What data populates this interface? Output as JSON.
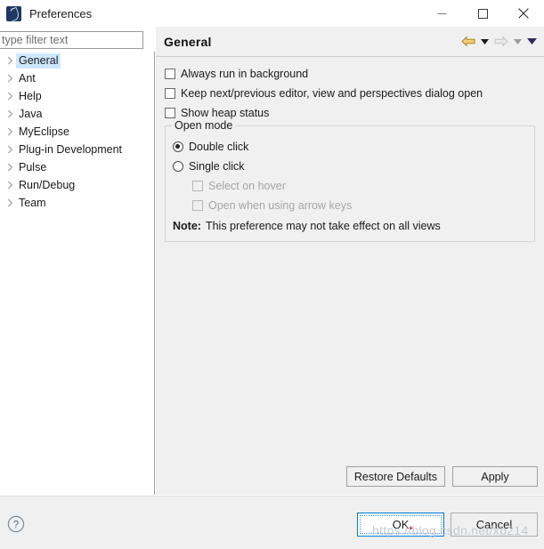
{
  "window": {
    "title": "Preferences",
    "app_icon": "myeclipse-logo-icon",
    "controls": {
      "minimize": "minimize-icon",
      "maximize": "maximize-icon",
      "close": "close-icon"
    }
  },
  "search": {
    "placeholder": "type filter text",
    "value": ""
  },
  "sidebar": {
    "items": [
      {
        "label": "General",
        "selected": true
      },
      {
        "label": "Ant",
        "selected": false
      },
      {
        "label": "Help",
        "selected": false
      },
      {
        "label": "Java",
        "selected": false
      },
      {
        "label": "MyEclipse",
        "selected": false
      },
      {
        "label": "Plug-in Development",
        "selected": false
      },
      {
        "label": "Pulse",
        "selected": false
      },
      {
        "label": "Run/Debug",
        "selected": false
      },
      {
        "label": "Team",
        "selected": false
      }
    ]
  },
  "content": {
    "title": "General",
    "nav": {
      "back": "back-arrow-icon",
      "back_menu": "dropdown-chevron-icon",
      "forward": "forward-arrow-icon",
      "forward_menu": "dropdown-chevron-icon",
      "view_menu": "view-menu-chevron-icon"
    },
    "checkboxes": [
      {
        "label": "Always run in background",
        "checked": false,
        "enabled": true
      },
      {
        "label": "Keep next/previous editor, view and perspectives dialog open",
        "checked": false,
        "enabled": true
      },
      {
        "label": "Show heap status",
        "checked": false,
        "enabled": true
      }
    ],
    "open_mode": {
      "title": "Open mode",
      "radios": [
        {
          "label": "Double click",
          "selected": true
        },
        {
          "label": "Single click",
          "selected": false
        }
      ],
      "sub_checkboxes": [
        {
          "label": "Select on hover",
          "checked": false,
          "enabled": false
        },
        {
          "label": "Open when using arrow keys",
          "checked": false,
          "enabled": false
        }
      ],
      "note_label": "Note:",
      "note_text": "This preference may not take effect on all views"
    },
    "buttons": {
      "restore_defaults": "Restore Defaults",
      "apply": "Apply"
    }
  },
  "footer": {
    "help_icon": "help-question-icon",
    "ok": "OK",
    "cancel": "Cancel",
    "watermark": "https://blog.csdn.net/xb214"
  },
  "colors": {
    "accent": "#0078d7",
    "selection": "#cde8ff",
    "panel": "#f0f0f0",
    "back_arrow": "#e8b33a",
    "forward_arrow": "#d6d6d6",
    "view_menu": "#2b2b60"
  }
}
